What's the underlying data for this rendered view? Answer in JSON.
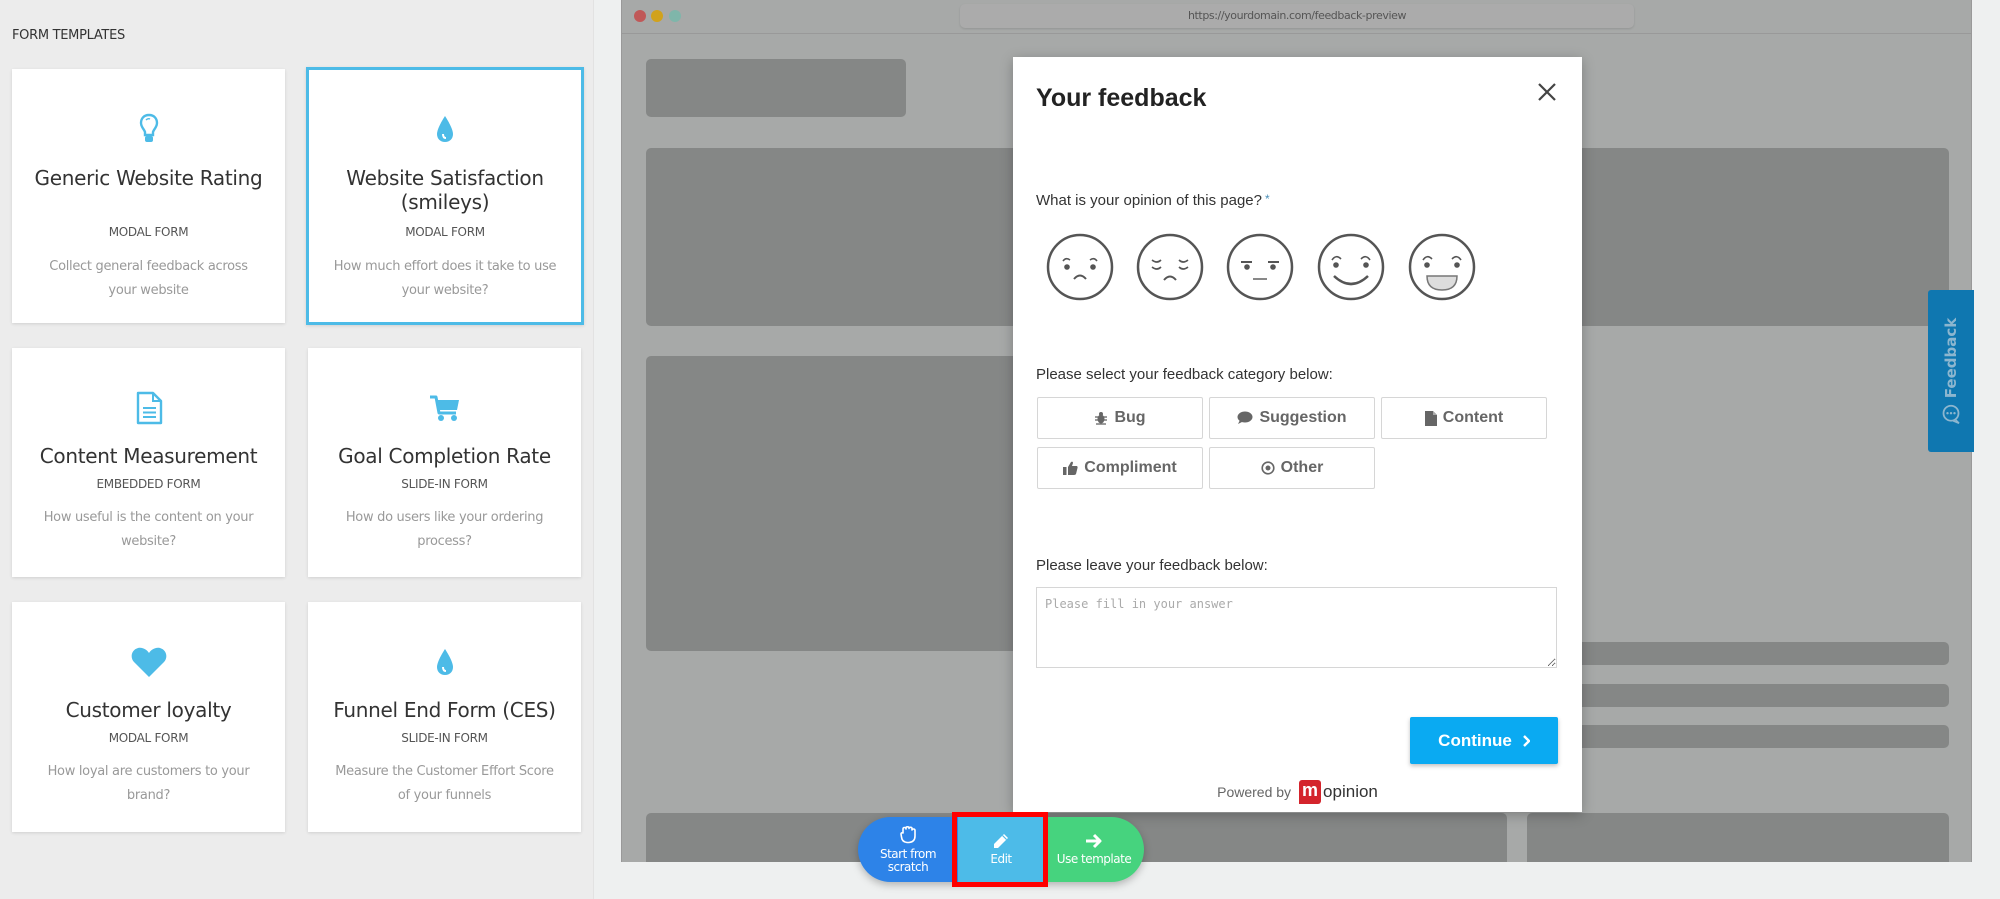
{
  "sidebar": {
    "title": "FORM TEMPLATES",
    "templates": [
      {
        "icon": "lightbulb-icon",
        "title": "Generic Website Rating",
        "type": "MODAL FORM",
        "description": "Collect general feedback across your website",
        "selected": false
      },
      {
        "icon": "drop-icon",
        "title": "Website Satisfaction (smileys)",
        "type": "MODAL FORM",
        "description": "How much effort does it take to use your website?",
        "selected": true
      },
      {
        "icon": "document-icon",
        "title": "Content Measurement",
        "type": "EMBEDDED FORM",
        "description": "How useful is the content on your website?",
        "selected": false
      },
      {
        "icon": "cart-icon",
        "title": "Goal Completion Rate",
        "type": "SLIDE-IN FORM",
        "description": "How do users like your ordering process?",
        "selected": false
      },
      {
        "icon": "heart-icon",
        "title": "Customer loyalty",
        "type": "MODAL FORM",
        "description": "How loyal are customers to your brand?",
        "selected": false
      },
      {
        "icon": "drop-icon",
        "title": "Funnel End Form (CES)",
        "type": "SLIDE-IN FORM",
        "description": "Measure the Customer Effort Score of your funnels",
        "selected": false
      }
    ]
  },
  "browser": {
    "url": "https://yourdomain.com/feedback-preview",
    "feedback_tab_label": "Feedback"
  },
  "modal": {
    "title": "Your feedback",
    "question1": "What is your opinion of this page?",
    "required_marker": "*",
    "smileys": [
      "very-unhappy",
      "unhappy",
      "neutral",
      "happy",
      "very-happy"
    ],
    "question2": "Please select your feedback category below:",
    "categories": [
      {
        "icon": "bug-icon",
        "label": "Bug"
      },
      {
        "icon": "comment-icon",
        "label": "Suggestion"
      },
      {
        "icon": "file-icon",
        "label": "Content"
      },
      {
        "icon": "thumbs-up-icon",
        "label": "Compliment"
      },
      {
        "icon": "dot-circle-icon",
        "label": "Other"
      }
    ],
    "question3": "Please leave your feedback below:",
    "textarea_placeholder": "Please fill in your answer",
    "textarea_value": "",
    "continue_label": "Continue",
    "powered_by": "Powered by",
    "brand_mark": "m",
    "brand_name": "opinion"
  },
  "actions": {
    "start_label_1": "Start from",
    "start_label_2": "scratch",
    "edit_label": "Edit",
    "use_label": "Use template"
  },
  "colors": {
    "accent": "#4dbbe7",
    "continue": "#0aaaf2",
    "start": "#2d83e8",
    "edit": "#4dbbe8",
    "use": "#46d37e",
    "feedback_tab": "#0f77b0",
    "highlight": "#ff0000"
  }
}
